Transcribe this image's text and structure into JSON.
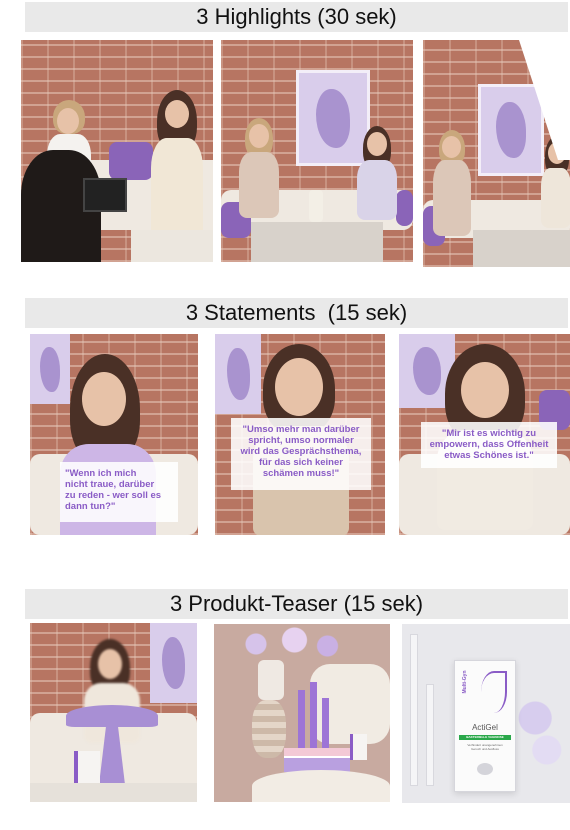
{
  "sections": [
    {
      "title": "3 Highlights (30 sek)"
    },
    {
      "title": "3 Statements  (15 sek)"
    },
    {
      "title": "3 Produkt-Teaser (15 sek)"
    }
  ],
  "statements": [
    "\"Wenn ich mich\nnicht traue, darüber\nzu reden - wer soll es\ndann tun?\"",
    "\"Umso mehr man darüber\nspricht, umso normaler\nwird das Gesprächsthema,\nfür das sich keiner\nschämen muss!\"",
    "\"Mir ist es wichtig zu\nempowern, dass Offenheit\netwas Schönes ist.\""
  ],
  "product": {
    "brand": "Multi-Gyn",
    "name": "ActiGel",
    "tagline": "BAKTERIELLE VAGINOSE",
    "description": "Verhindert unangenehmen\nGeruch und Ausfluss"
  },
  "colors": {
    "accent": "#8a5cc6",
    "band": "#e9e9e9",
    "brick": "#b77562"
  }
}
